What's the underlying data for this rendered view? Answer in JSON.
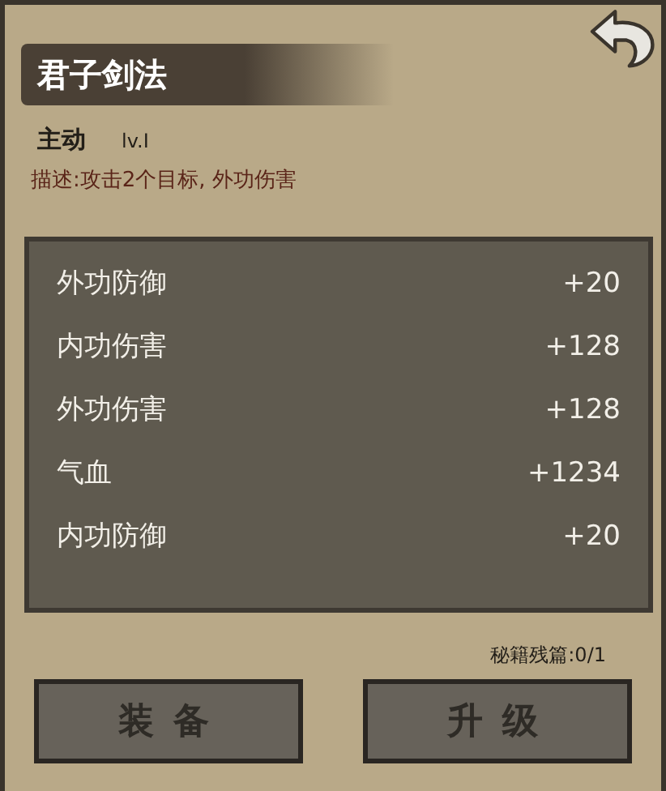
{
  "title": "君子剑法",
  "skill_type": "主动",
  "level_label": "lv.I",
  "description": "描述:攻击2个目标, 外功伤害",
  "stats": [
    {
      "name": "外功防御",
      "value": "+20"
    },
    {
      "name": "内功伤害",
      "value": "+128"
    },
    {
      "name": "外功伤害",
      "value": "+128"
    },
    {
      "name": "气血",
      "value": "+1234"
    },
    {
      "name": "内功防御",
      "value": "+20"
    }
  ],
  "fragments": "秘籍残篇:0/1",
  "buttons": [
    {
      "label": "装备"
    },
    {
      "label": "升级"
    }
  ]
}
